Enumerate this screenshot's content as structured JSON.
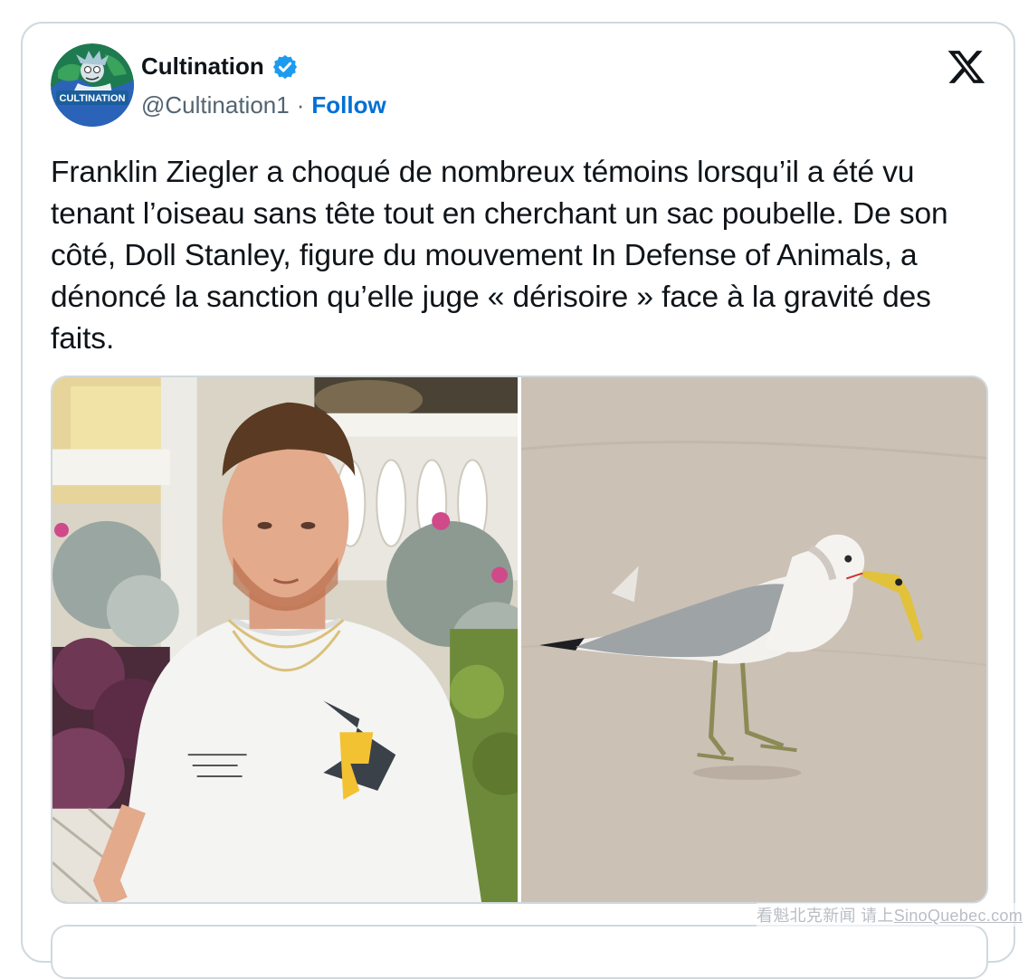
{
  "tweet": {
    "author": {
      "display_name": "Cultination",
      "handle": "@Cultination1",
      "separator": "·",
      "follow_label": "Follow",
      "verified": true,
      "avatar_text": "CULTINATION"
    },
    "text": "Franklin Ziegler a choqué de nombreux témoins lorsqu’il a été vu tenant l’oiseau sans tête tout en cherchant un sac poubelle. De son côté, Doll Stanley, figure du mouvement In Defense of Animals, a dénoncé la sanction qu’elle juge « dérisoire » face à la gravité des faits.",
    "media": [
      {
        "name": "photo-man",
        "subject": "man-in-white-tshirt"
      },
      {
        "name": "photo-seagull",
        "subject": "seagull-on-pavement"
      }
    ]
  },
  "colors": {
    "text": "#0f1419",
    "secondary": "#536471",
    "link": "#006fd6",
    "verified": "#1d9bf0",
    "border": "#cfd9de"
  },
  "icons": [
    "verified-badge-icon",
    "x-logo-icon"
  ],
  "watermark": {
    "prefix": "看魁北克新闻 请上",
    "site": "SinoQuebec.com"
  }
}
